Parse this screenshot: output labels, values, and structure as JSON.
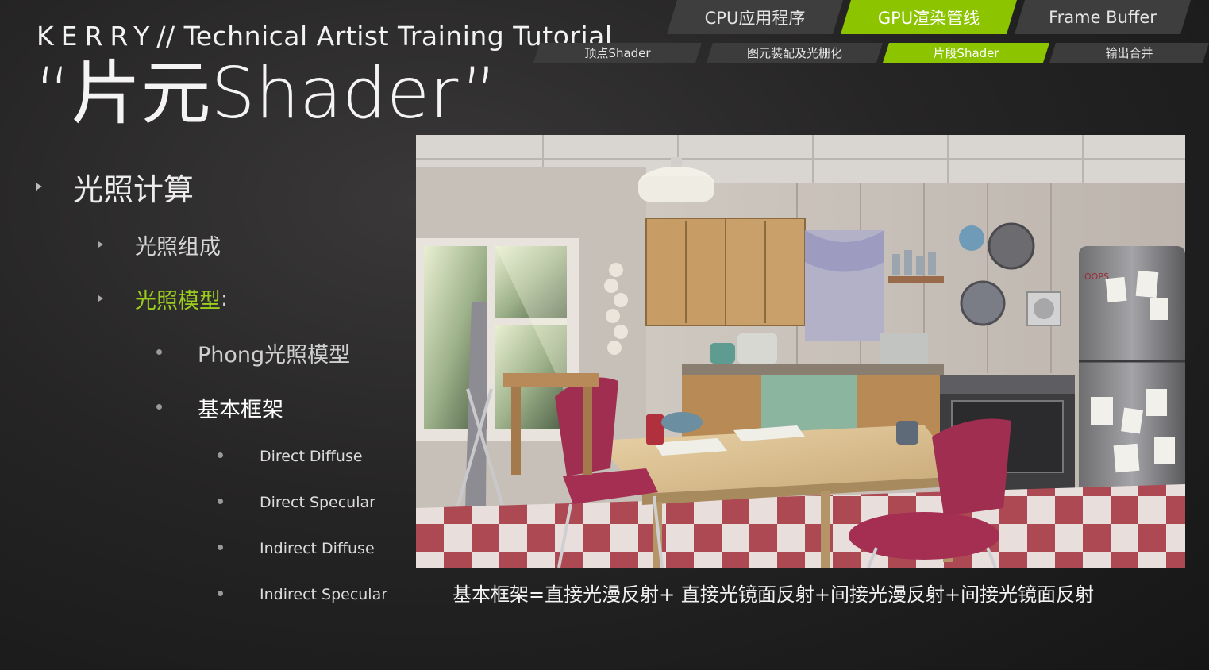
{
  "header": {
    "brand": "KERRY",
    "separator": "//",
    "course": "Technical Artist Training Tutorial"
  },
  "title": "“片元Shader”",
  "pipeline": {
    "stages": [
      {
        "label": "CPU应用程序",
        "active": false
      },
      {
        "label": "GPU渲染管线",
        "active": true
      },
      {
        "label": "Frame Buffer",
        "active": false
      }
    ],
    "substages": [
      {
        "label": "顶点Shader",
        "active": false
      },
      {
        "label": "图元装配及光栅化",
        "active": false
      },
      {
        "label": "片段Shader",
        "active": true
      },
      {
        "label": "输出合并",
        "active": false
      }
    ]
  },
  "outline": {
    "lighting_calc": "光照计算",
    "lighting_components": "光照组成",
    "lighting_models": "光照模型",
    "lighting_models_colon": ":",
    "phong_model": "Phong光照模型",
    "basic_framework": "基本框架",
    "terms": [
      "Direct Diffuse",
      "Direct Specular",
      "Indirect Diffuse",
      "Indirect Specular"
    ]
  },
  "figure": {
    "caption": "基本框架=直接光漫反射+ 直接光镜面反射+间接光漫反射+间接光镜面反射",
    "fridge_note": "OOPS"
  },
  "colors": {
    "accent_green": "#8cc400",
    "tab_gray": "#3e3e3e",
    "background": "#262525"
  }
}
